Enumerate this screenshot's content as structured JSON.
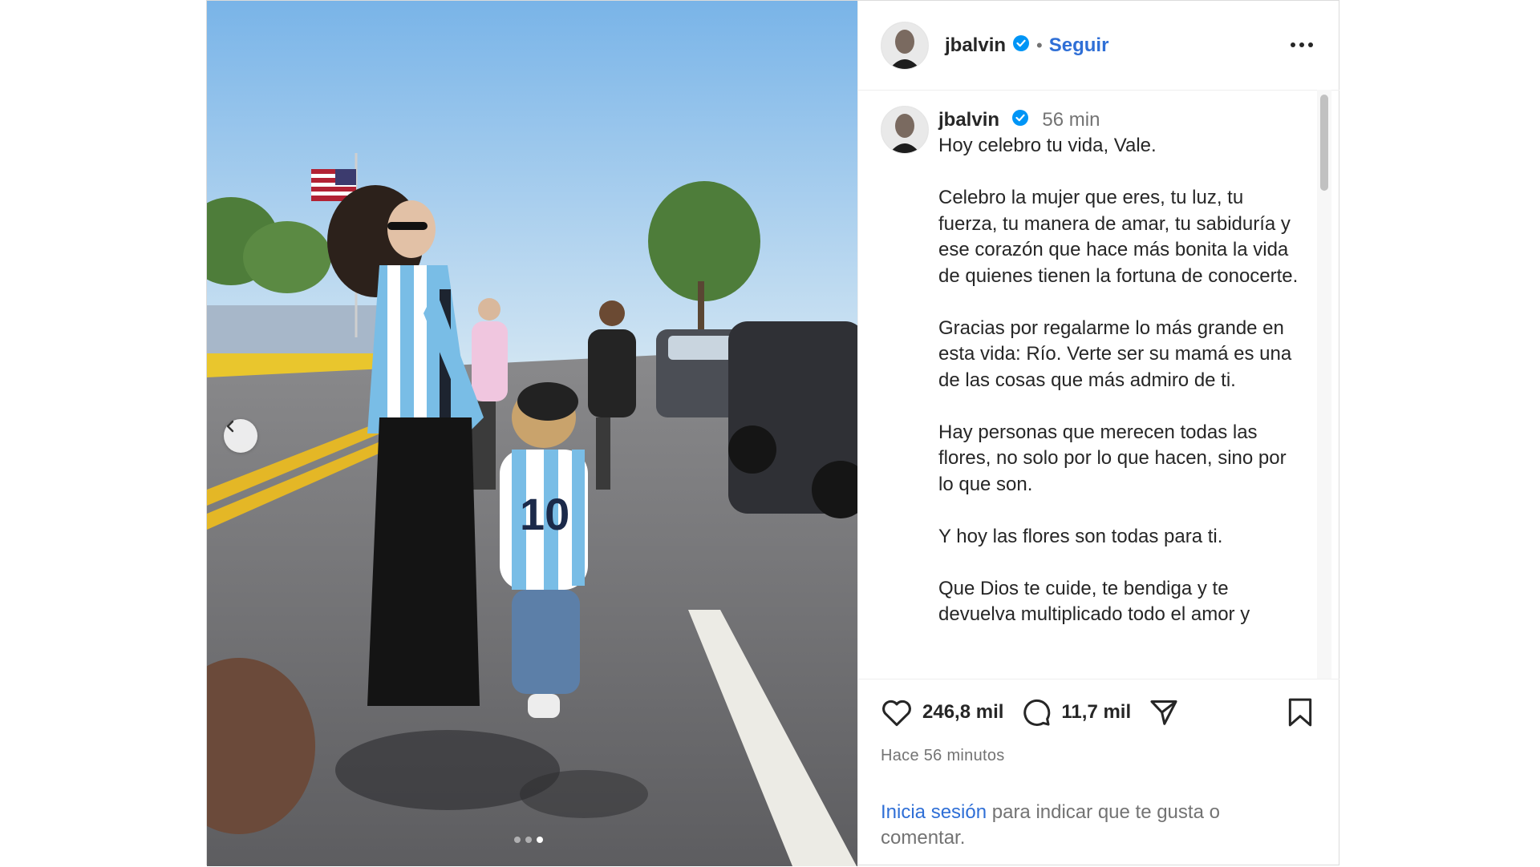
{
  "header": {
    "username": "jbalvin",
    "separator": "•",
    "follow_label": "Seguir",
    "more_label": "•••"
  },
  "caption": {
    "username": "jbalvin",
    "time": "56 min",
    "text": "Hoy celebro tu vida, Vale.\n\nCelebro la mujer que eres, tu luz, tu fuerza, tu manera de amar, tu sabiduría y ese corazón que hace más bonita la vida de quienes tienen la fortuna de conocerte.\n\nGracias por regalarme lo más grande en esta vida: Río. Verte ser su mamá es una de las cosas que más admiro de ti.\n\nHay personas que merecen todas las flores, no solo por lo que hacen, sino por lo que son.\n\nY hoy las flores son todas para ti.\n\nQue Dios te cuide, te bendiga y te devuelva multiplicado todo el amor y"
  },
  "actions": {
    "likes": "246,8 mil",
    "comments": "11,7 mil",
    "posted": "Hace 56 minutos",
    "login_link": "Inicia sesión",
    "login_rest": " para indicar que te gusta o comentar."
  },
  "carousel": {
    "total": 3,
    "active_index": 3
  },
  "colors": {
    "accent": "#2f6fd6",
    "verified": "#0095f6",
    "muted": "#737373"
  }
}
